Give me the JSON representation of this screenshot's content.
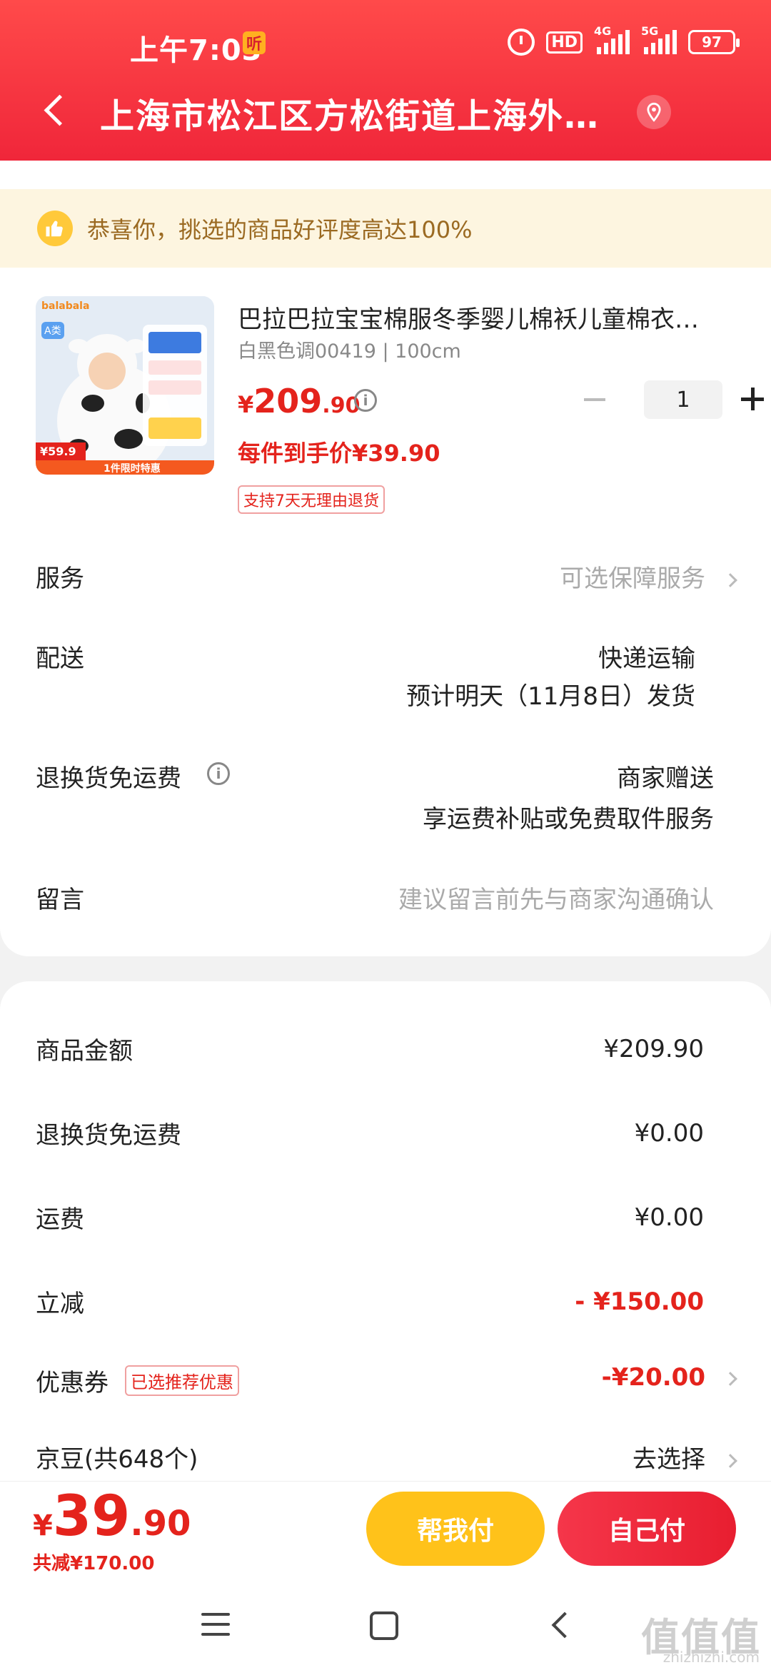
{
  "status_bar": {
    "time": "上午7:03",
    "listen_badge": "听",
    "hd": "HD",
    "signal_4g": "4G",
    "signal_5g": "5G",
    "battery": "97"
  },
  "header": {
    "address": "上海市松江区方松街道上海外…"
  },
  "notice": {
    "text": "恭喜你，挑选的商品好评度高达100%"
  },
  "product": {
    "image_brand": "balabala",
    "image_badge": "A类",
    "image_price": "¥59.9",
    "image_promo": "1件限时特惠",
    "title": "巴拉巴拉宝宝棉服冬季婴儿棉袄儿童棉衣…",
    "spec": "白黑色调00419 | 100cm",
    "price_currency": "¥",
    "price_integer": "209",
    "price_decimal": ".90",
    "unit_price": "每件到手价¥39.90",
    "return_tag": "支持7天无理由退货",
    "quantity": "1"
  },
  "rows": {
    "service_label": "服务",
    "service_value": "可选保障服务",
    "delivery_label": "配送",
    "delivery_value1": "快递运输",
    "delivery_value2": "预计明天（11月8日）发货",
    "return_ship_label": "退换货免运费",
    "return_ship_value1": "商家赠送",
    "return_ship_value2": "享运费补贴或免费取件服务",
    "message_label": "留言",
    "message_placeholder": "建议留言前先与商家沟通确认"
  },
  "summary": {
    "goods_label": "商品金额",
    "goods_value": "¥209.90",
    "return_fee_label": "退换货免运费",
    "return_fee_value": "¥0.00",
    "shipping_label": "运费",
    "shipping_value": "¥0.00",
    "discount_label": "立减",
    "discount_value": "- ¥150.00",
    "coupon_label": "优惠券",
    "coupon_tag": "已选推荐优惠",
    "coupon_value": "-¥20.00",
    "jingdou_label": "京豆(共648个)",
    "jingdou_value": "去选择"
  },
  "footer": {
    "total_currency": "¥",
    "total_integer": "39",
    "total_decimal": ".90",
    "total_reduce": "共减¥170.00",
    "help_pay": "帮我付",
    "self_pay": "自己付"
  },
  "watermark": {
    "main": "值值值",
    "sub": "zhizhizhi.com"
  },
  "colors": {
    "header_red": "#f0263a",
    "price_red": "#e4231c",
    "help_pay_yellow": "#ffc21a"
  }
}
